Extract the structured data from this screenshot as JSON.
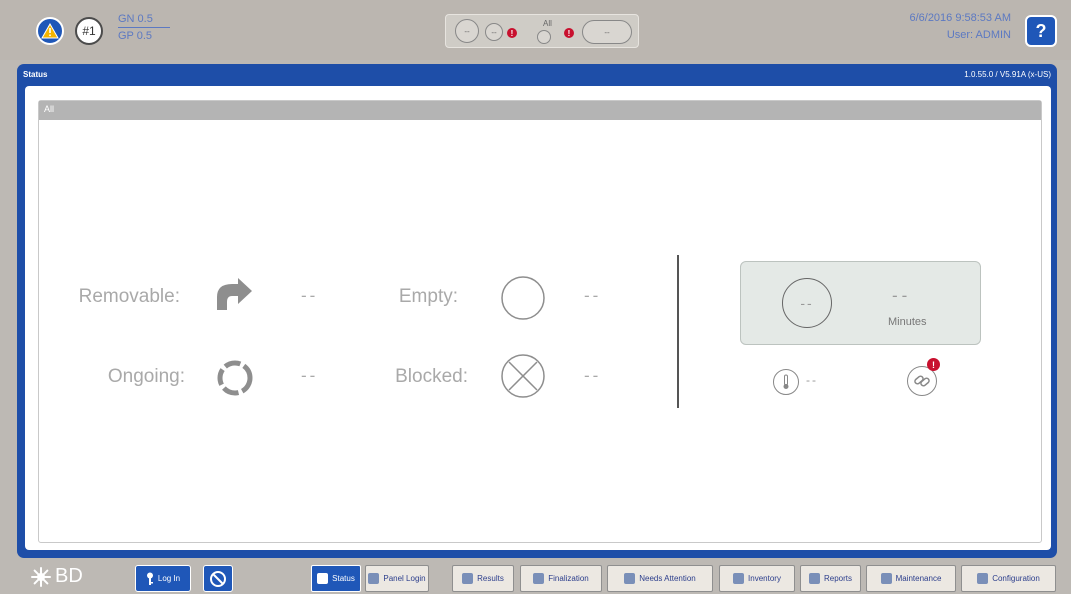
{
  "header": {
    "unit_label": "#1",
    "gn_label": "GN 0.5",
    "gp_label": "GP 0.5",
    "status_group": {
      "all_label": "All",
      "alert_glyph": "!",
      "dash": "--"
    },
    "datetime": "6/6/2016 9:58:53 AM",
    "user": "User: ADMIN",
    "help_label": "?"
  },
  "main": {
    "title": "Status",
    "version": "1.0.55.0 / V5.91A (x-US)",
    "section_title": "All",
    "status_items": [
      {
        "label": "Removable:",
        "value": "--",
        "icon": "curved-arrow-icon"
      },
      {
        "label": "Empty:",
        "value": "--",
        "icon": "empty-circle-icon"
      },
      {
        "label": "Ongoing:",
        "value": "--",
        "icon": "ongoing-cycle-icon"
      },
      {
        "label": "Blocked:",
        "value": "--",
        "icon": "blocked-x-icon"
      }
    ],
    "timer": {
      "circle_value": "--",
      "value": "--",
      "unit": "Minutes"
    },
    "temperature": {
      "value": "--",
      "icon": "thermometer-icon"
    },
    "connection": {
      "icon": "link-icon",
      "alert": "!"
    }
  },
  "footer": {
    "brand": "BD",
    "login_label": "Log In",
    "tabs": [
      {
        "label": "Status",
        "icon": "status-icon",
        "active": true
      },
      {
        "label": "Panel Login",
        "icon": "panel-login-icon"
      },
      {
        "label": "Results",
        "icon": "results-icon"
      },
      {
        "label": "Finalization",
        "icon": "finalization-icon"
      },
      {
        "label": "Needs Attention",
        "icon": "needs-attention-icon"
      },
      {
        "label": "Inventory",
        "icon": "inventory-icon"
      },
      {
        "label": "Reports",
        "icon": "reports-icon"
      },
      {
        "label": "Maintenance",
        "icon": "maintenance-icon"
      },
      {
        "label": "Configuration",
        "icon": "gear-icon"
      }
    ]
  },
  "colors": {
    "accent": "#1f57b8",
    "alert": "#c8102e",
    "muted_text": "#a9a9a9",
    "info_text": "#5c79c2"
  }
}
